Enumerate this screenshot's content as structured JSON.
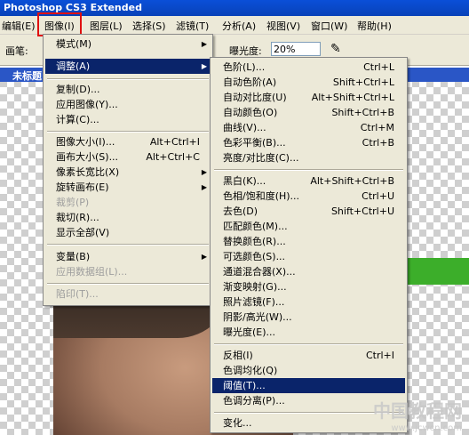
{
  "app_title": "Photoshop CS3 Extended",
  "menubar": {
    "items": [
      "编辑(E)",
      "图像(I)",
      "图层(L)",
      "选择(S)",
      "滤镜(T)",
      "分析(A)",
      "视图(V)",
      "窗口(W)",
      "帮助(H)"
    ]
  },
  "options_bar": {
    "brush_label": "画笔:",
    "exposure_label": "曝光度:",
    "exposure_value": "20%"
  },
  "document": {
    "title": "未标题"
  },
  "image_menu": {
    "items": [
      {
        "label": "模式(M)",
        "shortcut": "",
        "submenu": true
      },
      {
        "label": "调整(A)",
        "shortcut": "",
        "submenu": true,
        "highlighted": true
      },
      {
        "label": "复制(D)...",
        "shortcut": ""
      },
      {
        "label": "应用图像(Y)...",
        "shortcut": ""
      },
      {
        "label": "计算(C)...",
        "shortcut": ""
      },
      {
        "label": "图像大小(I)...",
        "shortcut": "Alt+Ctrl+I"
      },
      {
        "label": "画布大小(S)...",
        "shortcut": "Alt+Ctrl+C"
      },
      {
        "label": "像素长宽比(X)",
        "shortcut": "",
        "submenu": true
      },
      {
        "label": "旋转画布(E)",
        "shortcut": "",
        "submenu": true
      },
      {
        "label": "裁剪(P)",
        "shortcut": "",
        "disabled": true
      },
      {
        "label": "裁切(R)...",
        "shortcut": ""
      },
      {
        "label": "显示全部(V)",
        "shortcut": ""
      },
      {
        "label": "变量(B)",
        "shortcut": "",
        "submenu": true
      },
      {
        "label": "应用数据组(L)...",
        "shortcut": "",
        "disabled": true
      },
      {
        "label": "陷印(T)...",
        "shortcut": "",
        "disabled": true
      }
    ]
  },
  "adjust_menu": {
    "items": [
      {
        "label": "色阶(L)...",
        "shortcut": "Ctrl+L"
      },
      {
        "label": "自动色阶(A)",
        "shortcut": "Shift+Ctrl+L"
      },
      {
        "label": "自动对比度(U)",
        "shortcut": "Alt+Shift+Ctrl+L"
      },
      {
        "label": "自动颜色(O)",
        "shortcut": "Shift+Ctrl+B"
      },
      {
        "label": "曲线(V)...",
        "shortcut": "Ctrl+M"
      },
      {
        "label": "色彩平衡(B)...",
        "shortcut": "Ctrl+B"
      },
      {
        "label": "亮度/对比度(C)...",
        "shortcut": ""
      },
      {
        "label": "黑白(K)...",
        "shortcut": "Alt+Shift+Ctrl+B"
      },
      {
        "label": "色相/饱和度(H)...",
        "shortcut": "Ctrl+U"
      },
      {
        "label": "去色(D)",
        "shortcut": "Shift+Ctrl+U"
      },
      {
        "label": "匹配颜色(M)...",
        "shortcut": ""
      },
      {
        "label": "替换颜色(R)...",
        "shortcut": ""
      },
      {
        "label": "可选颜色(S)...",
        "shortcut": ""
      },
      {
        "label": "通道混合器(X)...",
        "shortcut": ""
      },
      {
        "label": "渐变映射(G)...",
        "shortcut": ""
      },
      {
        "label": "照片滤镜(F)...",
        "shortcut": ""
      },
      {
        "label": "阴影/高光(W)...",
        "shortcut": ""
      },
      {
        "label": "曝光度(E)...",
        "shortcut": ""
      },
      {
        "label": "反相(I)",
        "shortcut": "Ctrl+I"
      },
      {
        "label": "色调均化(Q)",
        "shortcut": ""
      },
      {
        "label": "阈值(T)...",
        "shortcut": "",
        "highlighted": true
      },
      {
        "label": "色调分离(P)...",
        "shortcut": ""
      },
      {
        "label": "变化...",
        "shortcut": ""
      }
    ]
  },
  "watermark": {
    "main": "中国教程网",
    "url": "www.jcwcn.com"
  },
  "colors": {
    "menu_highlight": "#0a246a",
    "annotation_box": "#e01010",
    "menu_bg": "#ece9d8"
  }
}
